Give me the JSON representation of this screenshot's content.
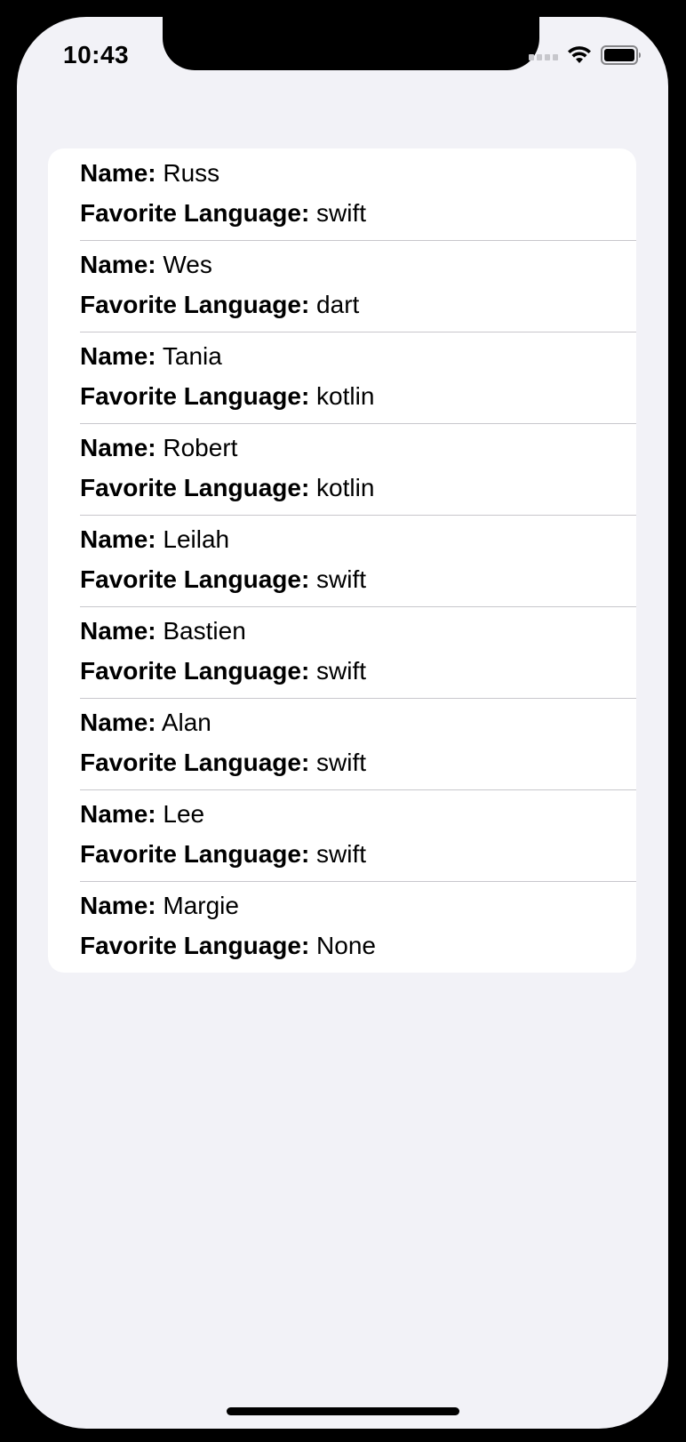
{
  "status_bar": {
    "time": "10:43",
    "icons": [
      "cellular-signal-icon",
      "wifi-icon",
      "battery-icon"
    ]
  },
  "labels": {
    "name": "Name:",
    "favorite_language": "Favorite Language:"
  },
  "people": [
    {
      "name": "Russ",
      "language": "swift"
    },
    {
      "name": "Wes",
      "language": "dart"
    },
    {
      "name": "Tania",
      "language": "kotlin"
    },
    {
      "name": "Robert",
      "language": "kotlin"
    },
    {
      "name": "Leilah",
      "language": "swift"
    },
    {
      "name": "Bastien",
      "language": "swift"
    },
    {
      "name": "Alan",
      "language": "swift"
    },
    {
      "name": "Lee",
      "language": "swift"
    },
    {
      "name": "Margie",
      "language": "None"
    }
  ],
  "colors": {
    "background": "#f2f2f7",
    "card": "#ffffff",
    "separator": "#c8c7cc",
    "text": "#000000"
  }
}
